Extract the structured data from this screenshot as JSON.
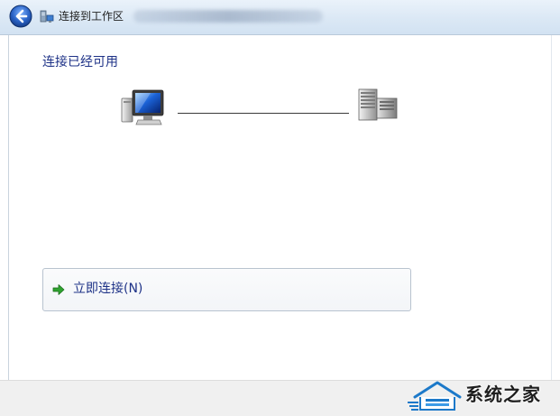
{
  "window": {
    "title": "连接到工作区",
    "subtitle_blurred": "(blurred address text)"
  },
  "main": {
    "status_heading": "连接已经可用",
    "connect_button_label": "立即连接(N)"
  },
  "icons": {
    "back": "back-arrow-icon",
    "network": "workplace-network-icon",
    "computer": "computer-icon",
    "server": "server-icon",
    "connect_arrow": "green-arrow-icon"
  },
  "watermark": {
    "text": "系统之家"
  },
  "colors": {
    "heading_text": "#1e3287",
    "titlebar": "#dbe8f5",
    "back_button": "#2a63c6",
    "arrow_green": "#2fa32f"
  }
}
